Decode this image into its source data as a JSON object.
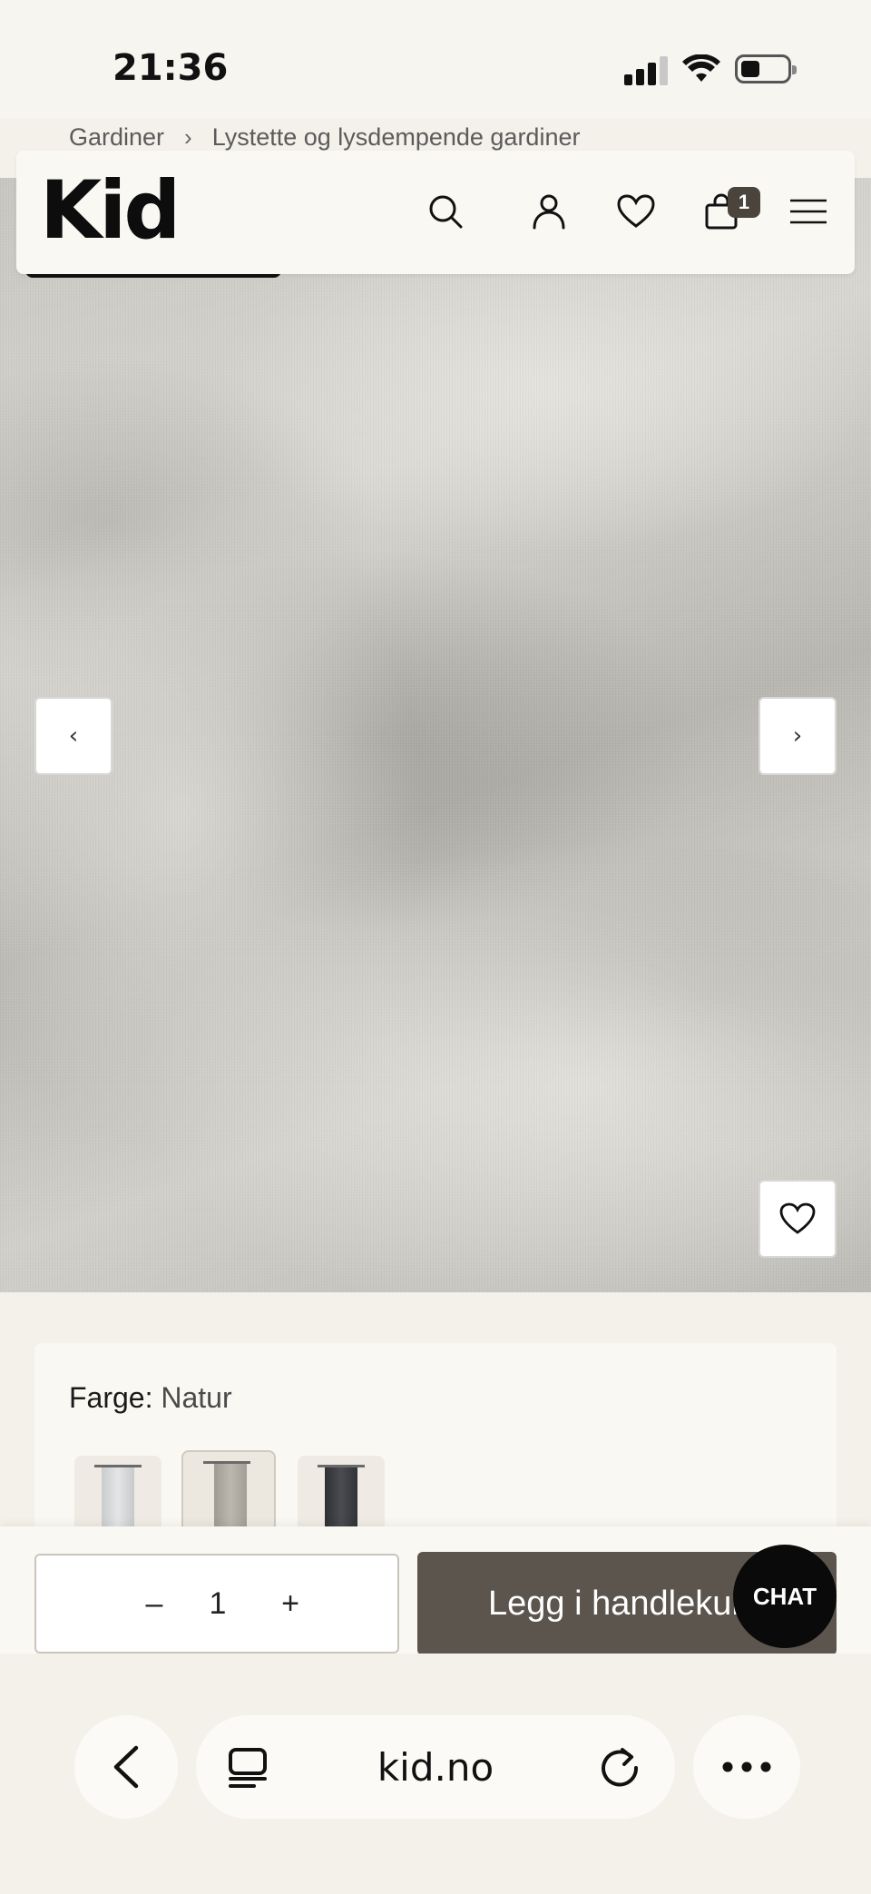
{
  "status_bar": {
    "time": "21:36"
  },
  "breadcrumb": {
    "items": [
      "Gardiner",
      "Lystette og lysdempende gardiner"
    ],
    "separator": "›"
  },
  "header": {
    "logo": "Kid",
    "cart_count": "1"
  },
  "hero": {
    "prev_label": "‹",
    "next_label": "›"
  },
  "options": {
    "color_key": "Farge:",
    "color_value": "Natur",
    "swatches": [
      {
        "name": "Hvit",
        "color": "#d9dbdd"
      },
      {
        "name": "Natur",
        "color": "#b4b0a8"
      },
      {
        "name": "Mørk grå",
        "color": "#3e3f44"
      }
    ]
  },
  "purchase": {
    "qty_minus": "–",
    "qty_value": "1",
    "qty_plus": "+",
    "add_to_cart": "Legg i handlekurv"
  },
  "chat": {
    "label": "CHAT"
  },
  "browser": {
    "url": "kid.no"
  },
  "colors": {
    "add_button": "#5c554d",
    "cart_badge": "#4a443d",
    "chat": "#0a0a0a"
  }
}
